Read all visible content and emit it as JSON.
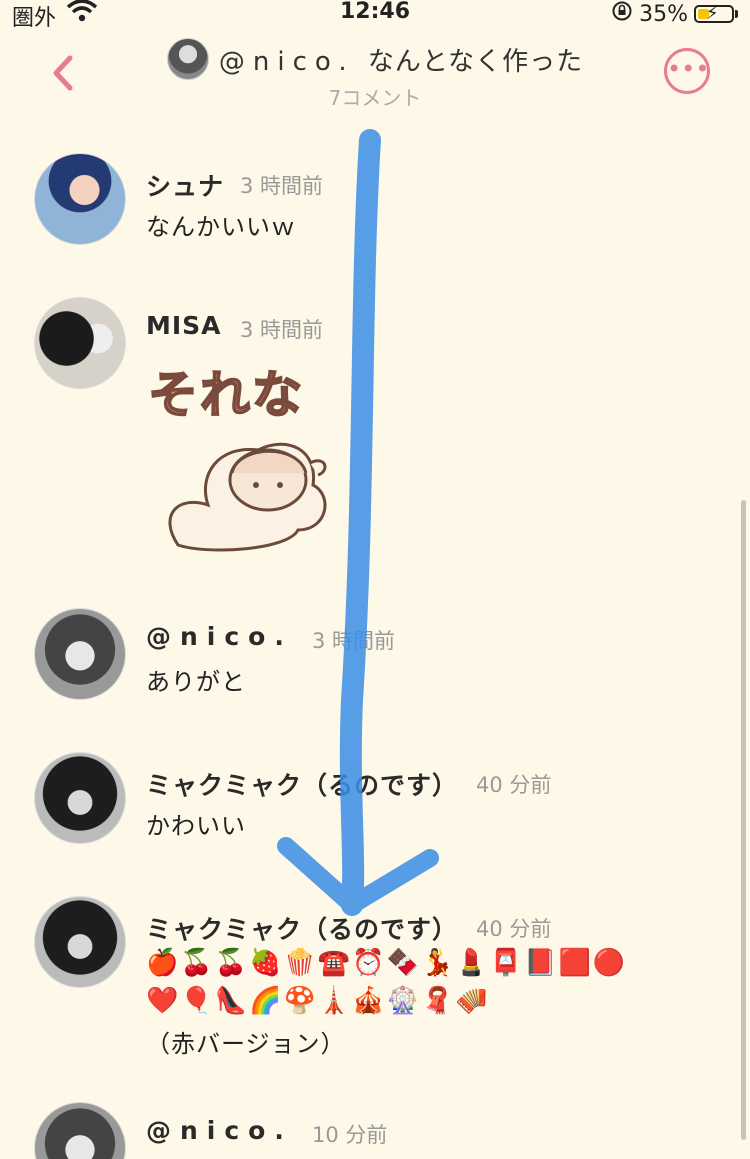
{
  "status_bar": {
    "carrier": "圏外",
    "time": "12:46",
    "battery": "35%",
    "battery_fraction": 0.35
  },
  "header": {
    "user": "@nico.",
    "title": "なんとなく作った",
    "comment_count": "7コメント"
  },
  "comments": [
    {
      "name": "シュナ",
      "time": "3 時間前",
      "text": "なんかいいｗ"
    },
    {
      "name": "MISA",
      "time": "3 時間前",
      "sticker_text": "それな"
    },
    {
      "name": "@nico.",
      "time": "3 時間前",
      "text": "ありがと"
    },
    {
      "name": "ミャクミャク（るのです）",
      "time": "40 分前",
      "text": "かわいい"
    },
    {
      "name": "ミャクミャク（るのです）",
      "time": "40 分前",
      "emoji_line_1": "🍎🍒🍒🍓🍿☎️⏰🍫💃💄📮📕🟥🔴",
      "emoji_line_2": "❤️🎈👠🌈🍄🗼🎪🎡🧣🪗",
      "text": "（赤バージョン）"
    },
    {
      "name": "@nico.",
      "time": "10 分前"
    }
  ],
  "colors": {
    "background": "#fdf8e8",
    "accent": "#e77d8e",
    "annotation_arrow": "#3b8ee6"
  }
}
